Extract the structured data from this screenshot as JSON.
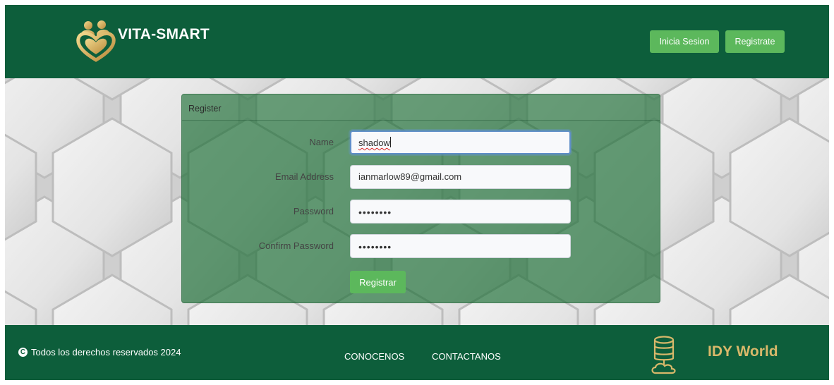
{
  "header": {
    "brand": "VITA-SMART",
    "login_label": "Inicia Sesion",
    "register_label": "Registrate"
  },
  "form": {
    "title": "Register",
    "fields": [
      {
        "label": "Name",
        "value": "shadow"
      },
      {
        "label": "Email Address",
        "value": "ianmarlow89@gmail.com"
      },
      {
        "label": "Password",
        "value": "••••••••"
      },
      {
        "label": "Confirm Password",
        "value": "••••••••"
      }
    ],
    "submit_label": "Registrar"
  },
  "footer": {
    "copyright": "Todos los derechos reservados 2024",
    "links": [
      "CONOCENOS",
      "CONTACTANOS"
    ],
    "company": "IDY World"
  },
  "colors": {
    "primary_green": "#0d5e3b",
    "button_green": "#5cb85c",
    "gold": "#d8b86a"
  }
}
